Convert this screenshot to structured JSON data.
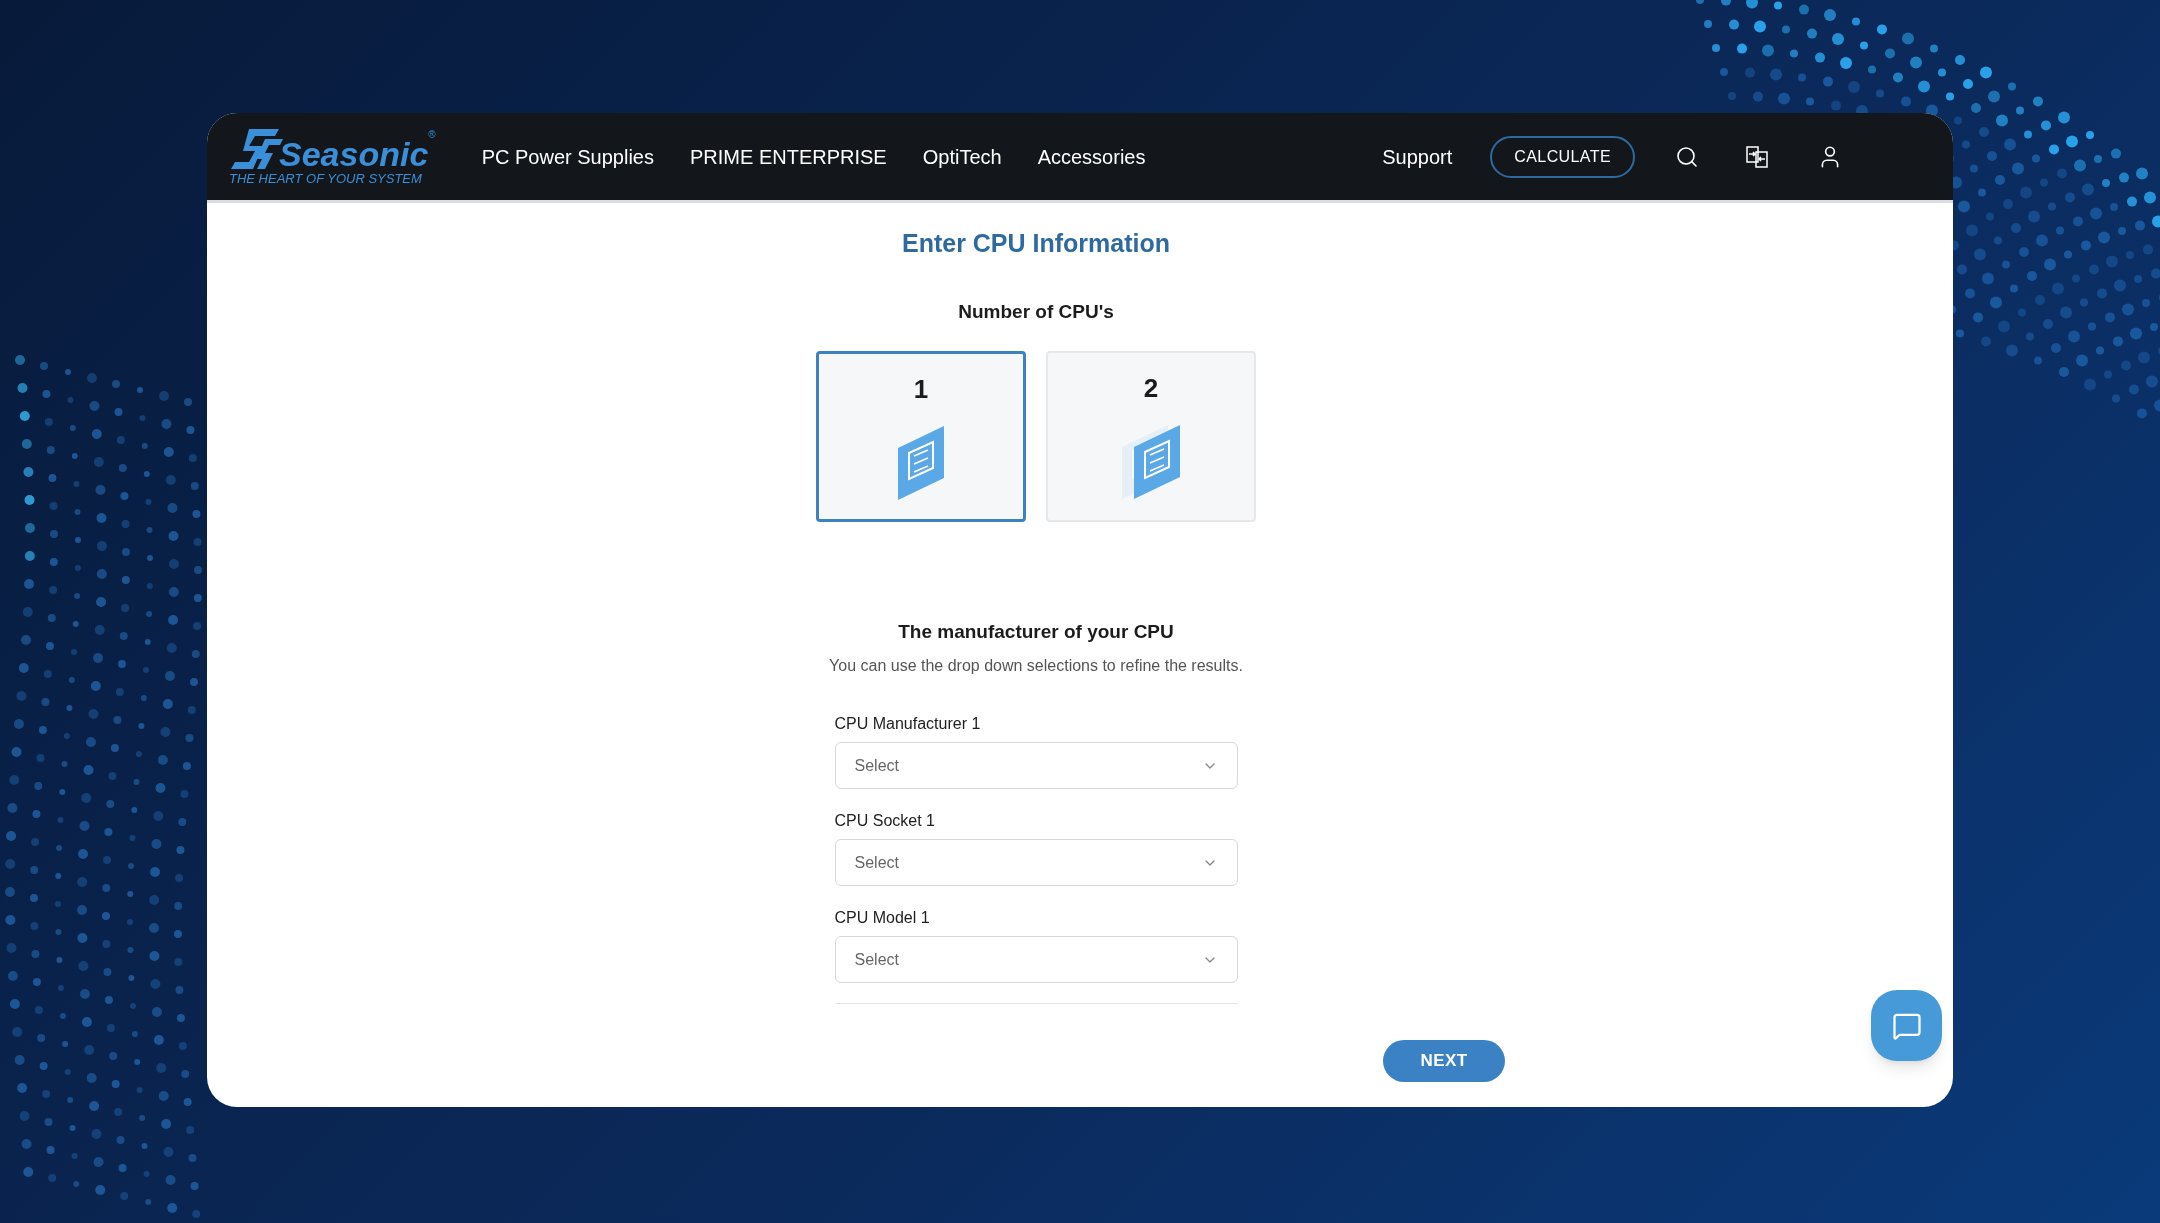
{
  "header": {
    "logo": {
      "name": "Seasonic",
      "mark": "®",
      "tagline": "THE HEART OF YOUR SYSTEM"
    },
    "nav": [
      "PC Power Supplies",
      "PRIME ENTERPRISE",
      "OptiTech",
      "Accessories"
    ],
    "support": "Support",
    "calculate": "CALCULATE"
  },
  "title": "Enter CPU Information",
  "cpu_count": {
    "label": "Number of CPU's",
    "options": [
      {
        "label": "1",
        "selected": true
      },
      {
        "label": "2",
        "selected": false
      }
    ]
  },
  "manufacturer_section": {
    "heading": "The manufacturer of your CPU",
    "hint": "You can use the drop down selections to refine the results.",
    "fields": [
      {
        "label": "CPU Manufacturer 1",
        "placeholder": "Select"
      },
      {
        "label": "CPU Socket 1",
        "placeholder": "Select"
      },
      {
        "label": "CPU Model 1",
        "placeholder": "Select"
      }
    ]
  },
  "next": "NEXT"
}
